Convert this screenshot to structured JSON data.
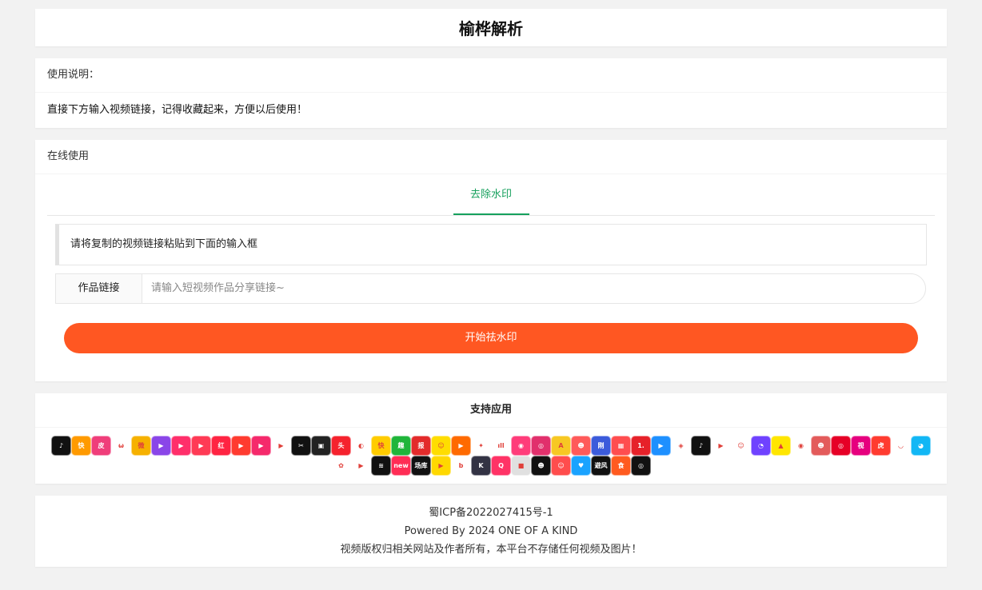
{
  "site": {
    "title": "榆桦解析"
  },
  "usage": {
    "header": "使用说明：",
    "text": "直接下方输入视频链接，记得收藏起来，方便以后使用！"
  },
  "online": {
    "header": "在线使用",
    "tab": "去除水印",
    "hint": "请将复制的视频链接粘贴到下面的输入框",
    "input_label": "作品链接",
    "input_placeholder": "请输入短视频作品分享链接~",
    "button": "开始祛水印"
  },
  "apps": {
    "header": "支持应用",
    "icons": [
      {
        "name": "tiktok-icon",
        "color": "#111111",
        "glyph": "♪"
      },
      {
        "name": "kuaishou-icon",
        "color": "#ff9a00",
        "glyph": "快"
      },
      {
        "name": "pipixia-icon",
        "color": "#ef3e7a",
        "glyph": "皮"
      },
      {
        "name": "weishi-icon",
        "color": "#ffffff",
        "glyph": "ω"
      },
      {
        "name": "weibo-icon",
        "color": "#f6b100",
        "glyph": "微"
      },
      {
        "name": "haokan-icon",
        "color": "#8a46e8",
        "glyph": "▶"
      },
      {
        "name": "meipai-icon",
        "color": "#ff2f6a",
        "glyph": "▶"
      },
      {
        "name": "lvzhou-icon",
        "color": "#ff3a55",
        "glyph": "▶"
      },
      {
        "name": "xiaohongshu-icon",
        "color": "#ff2442",
        "glyph": "红"
      },
      {
        "name": "huoshan-icon",
        "color": "#ff3b30",
        "glyph": "▶"
      },
      {
        "name": "xigua-icon",
        "color": "#f5296b",
        "glyph": "▶"
      },
      {
        "name": "iqiyi-icon",
        "color": "#ffffff",
        "glyph": "▶"
      },
      {
        "name": "capcut-icon",
        "color": "#111111",
        "glyph": "✂"
      },
      {
        "name": "live-icon",
        "color": "#222222",
        "glyph": "▣"
      },
      {
        "name": "toutiao-icon",
        "color": "#f5222d",
        "glyph": "头"
      },
      {
        "name": "tencent-video-icon",
        "color": "#ffffff",
        "glyph": "◐"
      },
      {
        "name": "kuai-icon",
        "color": "#ffcc00",
        "glyph": "快"
      },
      {
        "name": "qutoutiao-icon",
        "color": "#1fb53a",
        "glyph": "趣"
      },
      {
        "name": "kuaibao-icon",
        "color": "#e32b2b",
        "glyph": "报"
      },
      {
        "name": "zuiyou-icon",
        "color": "#ffdd00",
        "glyph": "☺"
      },
      {
        "name": "bilibili-play-icon",
        "color": "#ff6a00",
        "glyph": "▶"
      },
      {
        "name": "twitter-icon",
        "color": "#ffffff",
        "glyph": "✦"
      },
      {
        "name": "grass-icon",
        "color": "#ffffff",
        "glyph": "ıll"
      },
      {
        "name": "momo-icon",
        "color": "#ff3c7a",
        "glyph": "◉"
      },
      {
        "name": "instagram-icon",
        "color": "#e1306c",
        "glyph": "◎"
      },
      {
        "name": "acfun-icon",
        "color": "#f7c823",
        "glyph": "A"
      },
      {
        "name": "avatar-app-icon",
        "color": "#ff5a5a",
        "glyph": "☻"
      },
      {
        "name": "gang-icon",
        "color": "#3b5bdb",
        "glyph": "刚"
      },
      {
        "name": "film-icon",
        "color": "#ff4d4f",
        "glyph": "▦"
      },
      {
        "name": "yidian-icon",
        "color": "#e62129",
        "glyph": "1."
      },
      {
        "name": "youku-icon",
        "color": "#1e90ff",
        "glyph": "▶"
      },
      {
        "name": "aiqiyi-eye-icon",
        "color": "#ffffff",
        "glyph": "◈"
      },
      {
        "name": "douyin-icon",
        "color": "#111111",
        "glyph": "♪"
      },
      {
        "name": "youtube-icon",
        "color": "#ffffff",
        "glyph": "▶"
      },
      {
        "name": "panda-icon",
        "color": "#ffffff",
        "glyph": "☺"
      },
      {
        "name": "ghost-icon",
        "color": "#6f42ff",
        "glyph": "◔"
      },
      {
        "name": "drop-icon",
        "color": "#ffe600",
        "glyph": "▲"
      },
      {
        "name": "eye-icon",
        "color": "#ffffff",
        "glyph": "◉"
      },
      {
        "name": "face-icon",
        "color": "#e35b5b",
        "glyph": "☻"
      },
      {
        "name": "netease-icon",
        "color": "#e60026",
        "glyph": "◎"
      },
      {
        "name": "video-app-icon",
        "color": "#e6007e",
        "glyph": "视"
      },
      {
        "name": "tiger-icon",
        "color": "#ff3b30",
        "glyph": "虎"
      },
      {
        "name": "bowl-icon",
        "color": "#ffffff",
        "glyph": "◡"
      },
      {
        "name": "qq-icon",
        "color": "#12b7f5",
        "glyph": "◕"
      },
      {
        "name": "uc-icon",
        "color": "#ffffff",
        "glyph": "✿"
      },
      {
        "name": "play-triangle-icon",
        "color": "#ffffff",
        "glyph": "▶"
      },
      {
        "name": "stripe-icon",
        "color": "#111111",
        "glyph": "≋"
      },
      {
        "name": "new-icon",
        "color": "#ff2d55",
        "glyph": "new"
      },
      {
        "name": "changku-icon",
        "color": "#111111",
        "glyph": "场库"
      },
      {
        "name": "yellow-play-icon",
        "color": "#ffd800",
        "glyph": "▶"
      },
      {
        "name": "b-letter-icon",
        "color": "#ffffff",
        "glyph": "b"
      },
      {
        "name": "k-letter-icon",
        "color": "#333344",
        "glyph": "K"
      },
      {
        "name": "q-bubble-icon",
        "color": "#ff3366",
        "glyph": "Q"
      },
      {
        "name": "square-glow-icon",
        "color": "#e0e0e0",
        "glyph": "■"
      },
      {
        "name": "mascot-icon",
        "color": "#111111",
        "glyph": "☻"
      },
      {
        "name": "monkey-icon",
        "color": "#ff4d4d",
        "glyph": "☺"
      },
      {
        "name": "heart-wave-icon",
        "color": "#1aa3ff",
        "glyph": "♥"
      },
      {
        "name": "bifeng-icon",
        "color": "#111111",
        "glyph": "避风"
      },
      {
        "name": "food-icon",
        "color": "#ff5a1f",
        "glyph": "食"
      },
      {
        "name": "ring-icon",
        "color": "#111111",
        "glyph": "◎"
      }
    ]
  },
  "footer": {
    "icp": "蜀ICP备2022027415号-1",
    "powered": "Powered By 2024 ONE OF A KIND",
    "disclaimer": "视频版权归相关网站及作者所有，本平台不存储任何视频及图片！"
  }
}
